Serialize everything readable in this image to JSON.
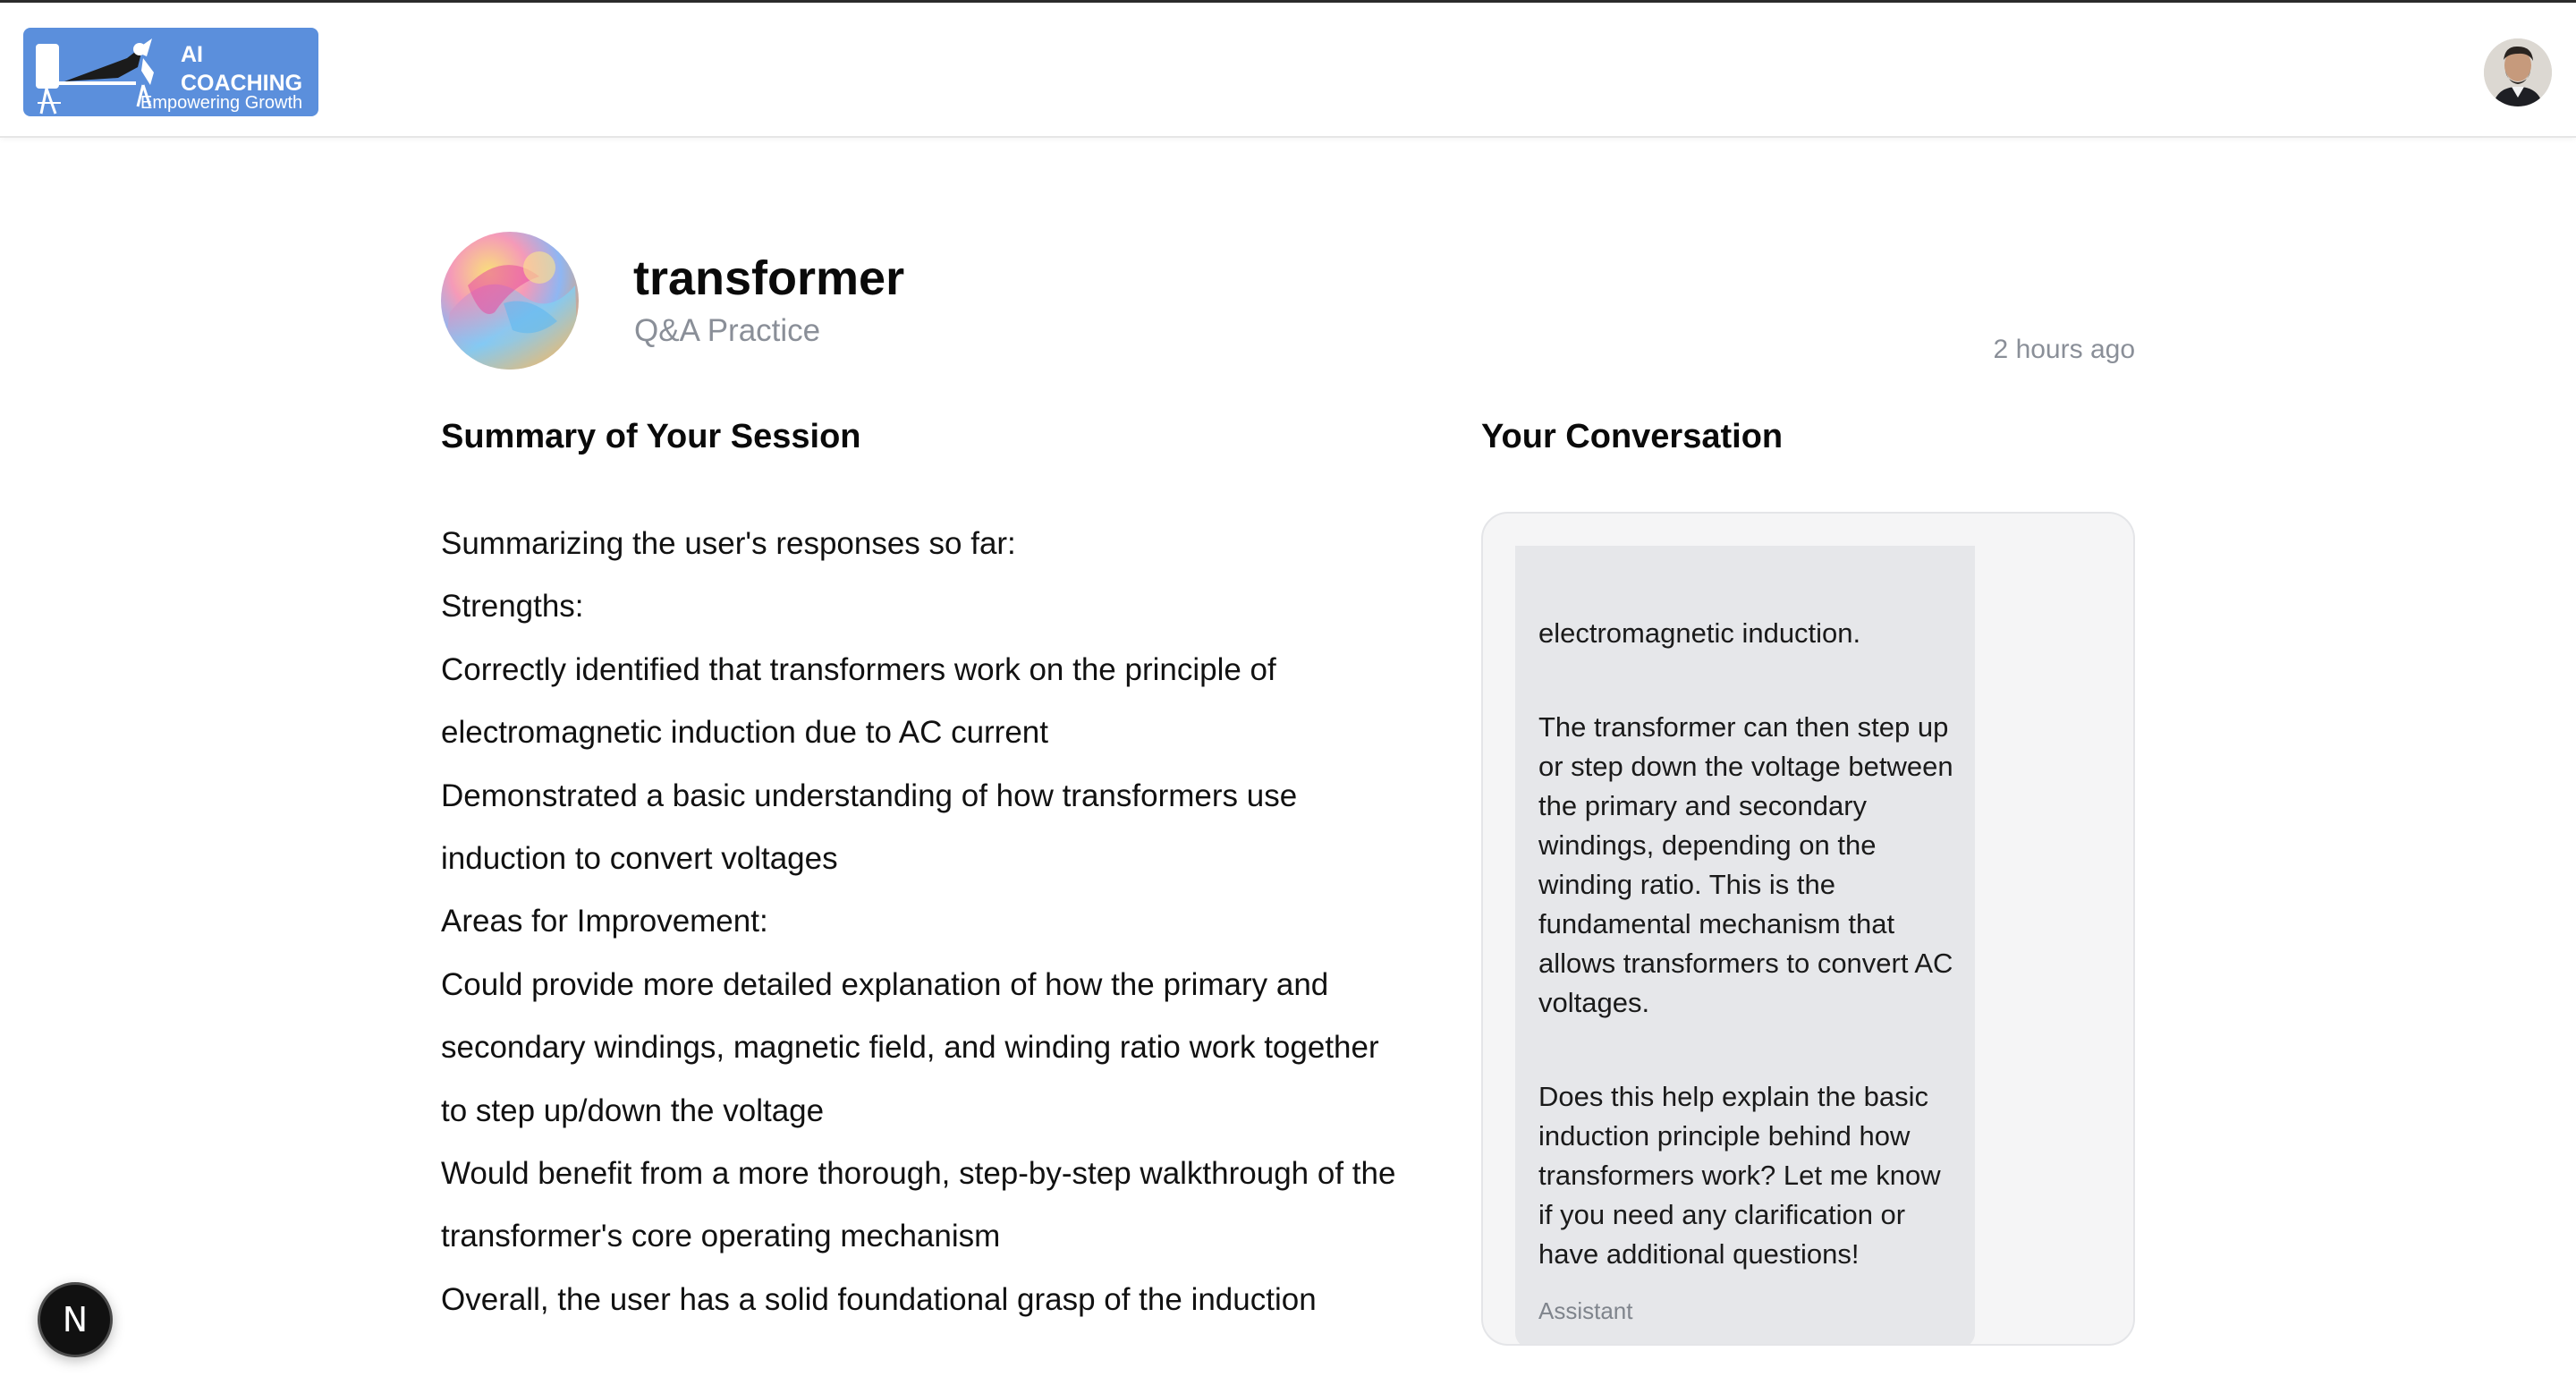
{
  "brand": {
    "title_line1": "AI",
    "title_line2": "COACHING",
    "tagline": "Empowering Growth"
  },
  "user": {
    "avatar_icon": "user-avatar"
  },
  "session": {
    "title": "transformer",
    "type": "Q&A Practice",
    "time": "2 hours ago"
  },
  "summary": {
    "heading": "Summary of Your Session",
    "lines": [
      "Summarizing the user's responses so far:",
      "Strengths:",
      "Correctly identified that transformers work on the principle of",
      "electromagnetic induction due to AC current",
      "Demonstrated a basic understanding of how transformers use",
      "induction to convert voltages",
      "Areas for Improvement:",
      "Could provide more detailed explanation of how the primary and",
      "secondary windings, magnetic field, and winding ratio work together",
      "to step up/down the voltage",
      "Would benefit from a more thorough, step-by-step walkthrough of the",
      "transformer's core operating mechanism",
      "Overall, the user has a solid foundational grasp of the induction"
    ]
  },
  "conversation": {
    "heading": "Your Conversation",
    "messages": [
      {
        "role": "Assistant",
        "paragraphs": [
          "electromagnetic induction.",
          "The transformer can then step up or step down the voltage between the primary and secondary windings, depending on the winding ratio. This is the fundamental mechanism that allows transformers to convert AC voltages.",
          "Does this help explain the basic induction principle behind how transformers work? Let me know if you need any clarification or have additional questions!"
        ]
      }
    ]
  },
  "footer": {
    "badge_letter": "N"
  }
}
